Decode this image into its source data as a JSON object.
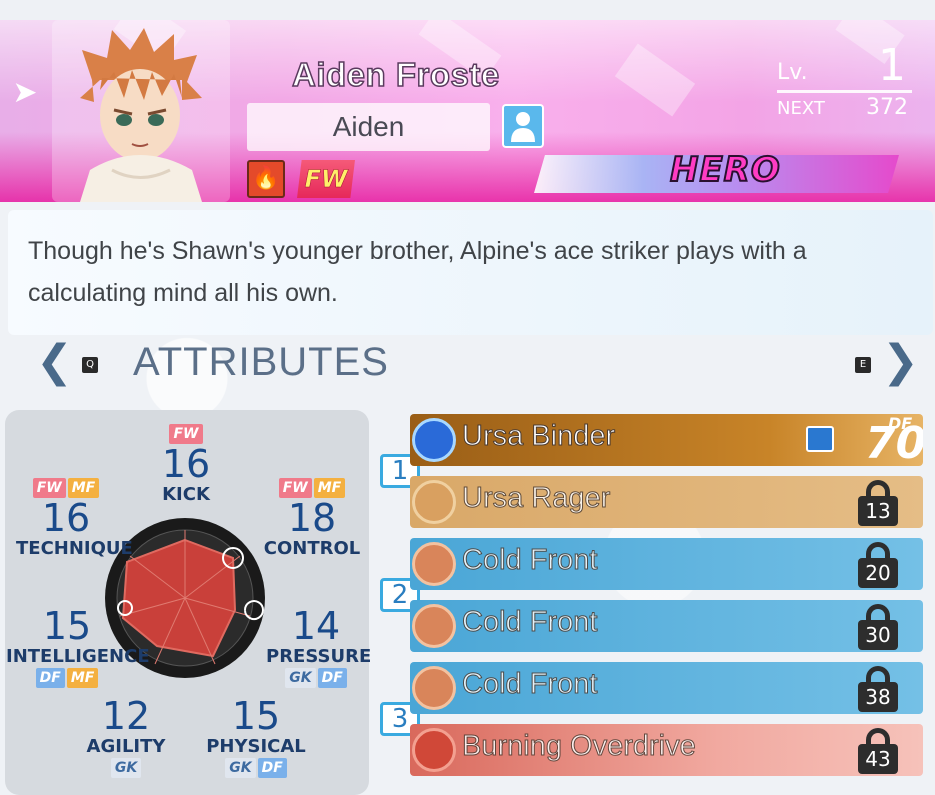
{
  "player": {
    "name": "Aiden Froste",
    "nickname": "Aiden",
    "position": "FW",
    "element": "fire",
    "rank": "HERO",
    "level_label": "Lv.",
    "level": "1",
    "next_label": "NEXT",
    "next_value": "372"
  },
  "description": "Though he's Shawn's younger brother, Alpine's ace striker plays with a calculating mind all his own.",
  "attributes": {
    "title": "ATTRIBUTES",
    "prev_key": "Q",
    "next_key": "E",
    "stats": {
      "kick": {
        "label": "KICK",
        "value": "16",
        "tags": [
          "FW"
        ]
      },
      "control": {
        "label": "CONTROL",
        "value": "18",
        "tags": [
          "FW",
          "MF"
        ]
      },
      "pressure": {
        "label": "PRESSURE",
        "value": "14",
        "tags": [
          "GK",
          "DF"
        ]
      },
      "physical": {
        "label": "PHYSICAL",
        "value": "15",
        "tags": [
          "GK",
          "DF"
        ]
      },
      "agility": {
        "label": "AGILITY",
        "value": "12",
        "tags": [
          "GK"
        ]
      },
      "intelligence": {
        "label": "INTELLIGENCE",
        "value": "15",
        "tags": [
          "DF",
          "MF"
        ]
      },
      "technique": {
        "label": "TECHNIQUE",
        "value": "16",
        "tags": [
          "FW",
          "MF"
        ]
      }
    }
  },
  "moves": {
    "groups": [
      "1",
      "2",
      "3"
    ],
    "items": [
      {
        "name": "Ursa Binder",
        "type_label": "DF",
        "power": "70",
        "locked": false,
        "color": "#b87520"
      },
      {
        "name": "Ursa Rager",
        "unlock": "13",
        "locked": true,
        "color": "#ddb079"
      },
      {
        "name": "Cold Front",
        "unlock": "20",
        "locked": true,
        "color": "#5fb5df"
      },
      {
        "name": "Cold Front",
        "unlock": "30",
        "locked": true,
        "color": "#5fb5df"
      },
      {
        "name": "Cold Front",
        "unlock": "38",
        "locked": true,
        "color": "#5fb5df"
      },
      {
        "name": "Burning Overdrive",
        "unlock": "43",
        "locked": true,
        "color": "#e6877c"
      }
    ]
  },
  "colors": {
    "accent_blue": "#3aaae0",
    "hero_pink": "#ff3cc4",
    "stat_text": "#1a4a8a"
  }
}
